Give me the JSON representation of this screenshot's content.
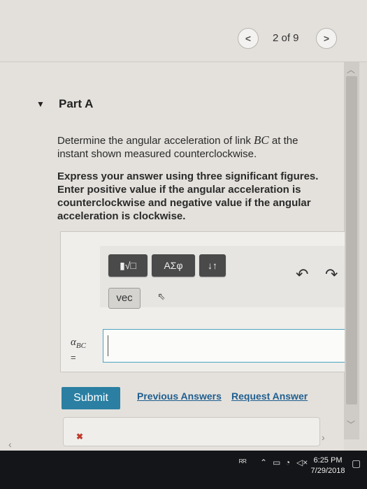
{
  "navigation": {
    "prev_label": "<",
    "next_label": ">",
    "page_indicator": "2 of 9"
  },
  "part": {
    "toggle_icon": "caret-down-icon",
    "title": "Part A"
  },
  "question": {
    "text_before": "Determine the angular acceleration of link ",
    "variable": "BC",
    "text_after": " at the instant shown measured counterclockwise."
  },
  "instructions": "Express your answer using three significant figures. Enter positive value if the angular acceleration is counterclockwise and negative value if the angular acceleration is clockwise.",
  "toolbar": {
    "templates_label": "▮√□",
    "greek_label": "ΑΣφ",
    "sort_label": "↓↑",
    "vec_label": "vec",
    "undo_icon": "undo-icon",
    "redo_icon": "redo-icon"
  },
  "answer": {
    "var_symbol": "α",
    "var_subscript": "BC",
    "equals": "=",
    "value": ""
  },
  "actions": {
    "submit_label": "Submit",
    "previous_answers_label": "Previous Answers",
    "request_answer_label": "Request Answer"
  },
  "taskbar": {
    "time": "6:25 PM",
    "date": "7/29/2018"
  },
  "colors": {
    "accent": "#2a7fa2",
    "link": "#1f5e8f",
    "input_border": "#4da3bd"
  }
}
